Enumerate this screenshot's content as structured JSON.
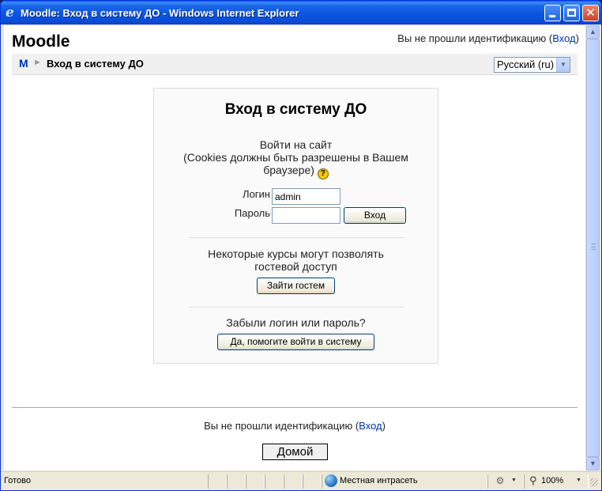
{
  "window": {
    "title": "Moodle: Вход в систему ДО - Windows Internet Explorer",
    "minimize_label": "",
    "maximize_label": "",
    "close_label": "✕"
  },
  "header": {
    "site_name": "Moodle",
    "login_info_prefix": "Вы не прошли идентификацию (",
    "login_link": "Вход",
    "login_info_suffix": ")"
  },
  "navbar": {
    "home_short": "M",
    "separator": "►",
    "current": "Вход в систему ДО",
    "language_selected": "Русский (ru)"
  },
  "login": {
    "title": "Вход в систему ДО",
    "desc_line1": "Войти на сайт",
    "desc_line2": "(Cookies должны быть разрешены в Вашем браузере)",
    "help_glyph": "?",
    "username_label": "Логин",
    "username_value": "admin",
    "password_label": "Пароль",
    "password_value": "",
    "login_button": "Вход",
    "guest_text": "Некоторые курсы могут позволять гостевой доступ",
    "guest_button": "Зайти гостем",
    "forgot_text": "Забыли логин или пароль?",
    "forgot_button": "Да, помогите войти в систему"
  },
  "footer": {
    "login_info_prefix": "Вы не прошли идентификацию (",
    "login_link": "Вход",
    "login_info_suffix": ")",
    "home_button": "Домой"
  },
  "statusbar": {
    "status": "Готово",
    "zone": "Местная интрасеть",
    "zoom": "100%"
  },
  "colors": {
    "link": "#0033aa",
    "titlebar": "#0a54e0",
    "chrome": "#ece9d8"
  }
}
